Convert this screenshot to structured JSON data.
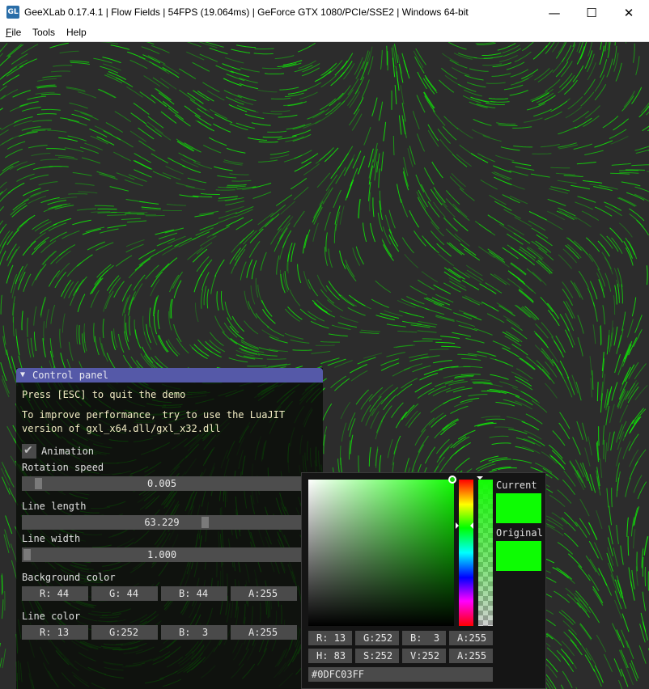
{
  "window": {
    "title": "GeeXLab 0.17.4.1 | Flow Fields | 54FPS (19.064ms) | GeForce GTX 1080/PCIe/SSE2 | Windows 64-bit",
    "minimize": "—",
    "maximize": "☐",
    "close": "✕",
    "icon": "geexlab-app-icon"
  },
  "menu": [
    {
      "accel": "F",
      "rest": "ile"
    },
    {
      "accel": "",
      "rest": "Tools"
    },
    {
      "accel": "",
      "rest": "Help"
    }
  ],
  "colors": {
    "background": "#2c2c2c",
    "line": "#0dfc03",
    "panel_header": "#5559a8",
    "hint_text": "#f2ecc4"
  },
  "panel": {
    "title": "Control panel",
    "collapse_icon": "▼",
    "esc_hint": "Press [ESC] to quit the demo",
    "perf_hint_line1": "To improve performance, try to use the LuaJIT",
    "perf_hint_line2": "version of gxl_x64.dll/gxl_x32.dll",
    "animation_label": "Animation",
    "animation_checked": true,
    "check_glyph": "✔",
    "rotation_speed_label": "Rotation speed",
    "rotation_speed": "0.005",
    "line_length_label": "Line length",
    "line_length": "63.229",
    "line_width_label": "Line width",
    "line_width": "1.000",
    "background_color_label": "Background color",
    "background_channels": [
      "R: 44",
      "G: 44",
      "B: 44",
      "A:255"
    ],
    "line_color_label": "Line color",
    "line_channels": [
      "R: 13",
      "G:252",
      "B:  3",
      "A:255"
    ]
  },
  "picker": {
    "current_label": "Current",
    "original_label": "Original",
    "current_color": "#0dfc03",
    "original_color": "#0dfc03",
    "rgba": [
      "R: 13",
      "G:252",
      "B:  3",
      "A:255"
    ],
    "hsv": [
      "H: 83",
      "S:252",
      "V:252",
      "A:255"
    ],
    "hex": "#0DFC03FF"
  }
}
